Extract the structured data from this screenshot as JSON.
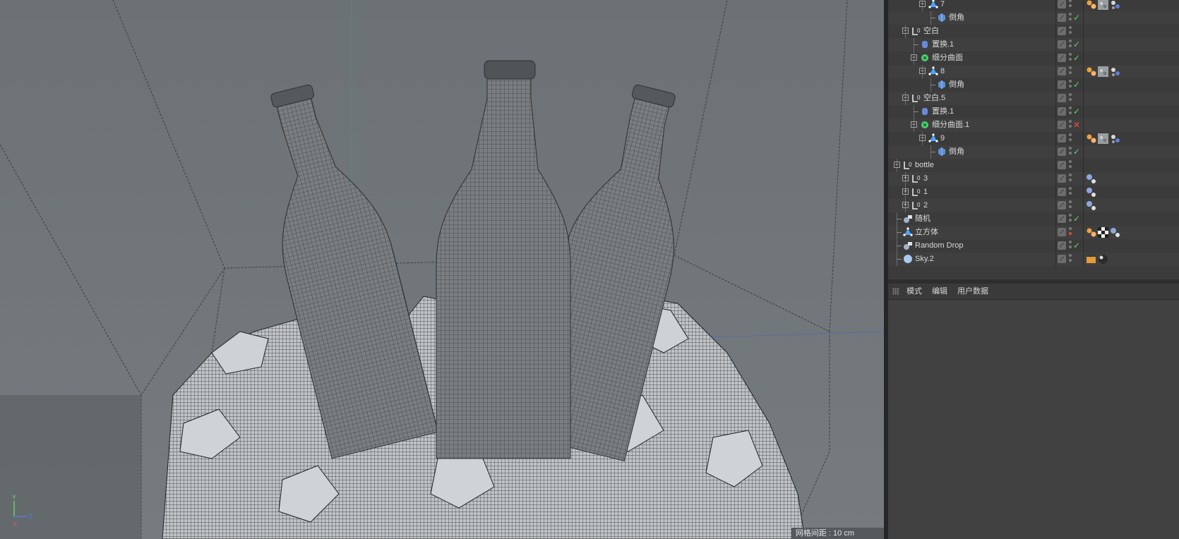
{
  "viewport": {
    "grid_readout": "网格间距 : 10 cm",
    "axis_labels": {
      "y": "Y",
      "z": "Z",
      "x": "X"
    }
  },
  "object_manager": {
    "rows": [
      {
        "label": "7",
        "depth": 3,
        "icon": "polygon-object-icon",
        "expander": "minus",
        "state": "none",
        "tags": [
          "material-tag",
          "texture-preview-tag",
          "selection-tag"
        ]
      },
      {
        "label": "倒角",
        "depth": 4,
        "icon": "bevel-deformer-icon",
        "expander": "",
        "state": "check",
        "tags": []
      },
      {
        "label": "空白",
        "depth": 1,
        "icon": "null-object-icon",
        "expander": "minus",
        "state": "none",
        "tags": []
      },
      {
        "label": "置换.1",
        "depth": 2,
        "icon": "displacer-icon",
        "expander": "",
        "state": "check",
        "tags": []
      },
      {
        "label": "细分曲面",
        "depth": 2,
        "icon": "subdivision-surface-icon",
        "expander": "minus",
        "state": "check",
        "tags": []
      },
      {
        "label": "8",
        "depth": 3,
        "icon": "polygon-object-icon",
        "expander": "minus",
        "state": "none",
        "tags": [
          "material-tag",
          "texture-preview-tag",
          "selection-tag"
        ]
      },
      {
        "label": "倒角",
        "depth": 4,
        "icon": "bevel-deformer-icon",
        "expander": "",
        "state": "check",
        "tags": []
      },
      {
        "label": "空白.5",
        "depth": 1,
        "icon": "null-object-icon",
        "expander": "minus",
        "state": "none",
        "tags": []
      },
      {
        "label": "置换.1",
        "depth": 2,
        "icon": "displacer-icon",
        "expander": "",
        "state": "check",
        "tags": []
      },
      {
        "label": "细分曲面.1",
        "depth": 2,
        "icon": "subdivision-surface-icon",
        "expander": "minus",
        "state": "cross",
        "tags": []
      },
      {
        "label": "9",
        "depth": 3,
        "icon": "polygon-object-icon",
        "expander": "minus",
        "state": "none",
        "tags": [
          "material-tag",
          "texture-preview-tag",
          "selection-tag"
        ]
      },
      {
        "label": "倒角",
        "depth": 4,
        "icon": "bevel-deformer-icon",
        "expander": "",
        "state": "check",
        "tags": []
      },
      {
        "label": "bottle",
        "depth": 0,
        "icon": "null-object-icon",
        "expander": "minus",
        "state": "none",
        "tags": []
      },
      {
        "label": "3",
        "depth": 1,
        "icon": "null-object-icon",
        "expander": "plus",
        "state": "none",
        "tags": [
          "rigid-body-tag"
        ]
      },
      {
        "label": "1",
        "depth": 1,
        "icon": "null-object-icon",
        "expander": "plus",
        "state": "none",
        "tags": [
          "rigid-body-tag"
        ]
      },
      {
        "label": "2",
        "depth": 1,
        "icon": "null-object-icon",
        "expander": "plus",
        "state": "none",
        "tags": [
          "rigid-body-tag"
        ]
      },
      {
        "label": "随机",
        "depth": 0,
        "icon": "random-effector-icon",
        "expander": "",
        "state": "check",
        "tags": []
      },
      {
        "label": "立方体",
        "depth": 0,
        "icon": "polygon-object-icon",
        "expander": "",
        "state": "dot-red",
        "tags": [
          "material-tag",
          "checker-texture-tag",
          "rigid-body-tag"
        ]
      },
      {
        "label": "Random Drop",
        "depth": 0,
        "icon": "random-effector-icon",
        "expander": "",
        "state": "check",
        "tags": []
      },
      {
        "label": "Sky.2",
        "depth": 0,
        "icon": "sky-object-icon",
        "expander": "",
        "state": "none",
        "tags": [
          "compositing-tag",
          "sky-material-tag"
        ]
      }
    ]
  },
  "attribute_manager": {
    "menu": [
      "模式",
      "编辑",
      "用户数据"
    ]
  },
  "colors": {
    "viewport_bg": "#6f7478",
    "panel_bg": "#3b3b3b",
    "check": "#5fd36a",
    "cross": "#ff4a3a"
  }
}
